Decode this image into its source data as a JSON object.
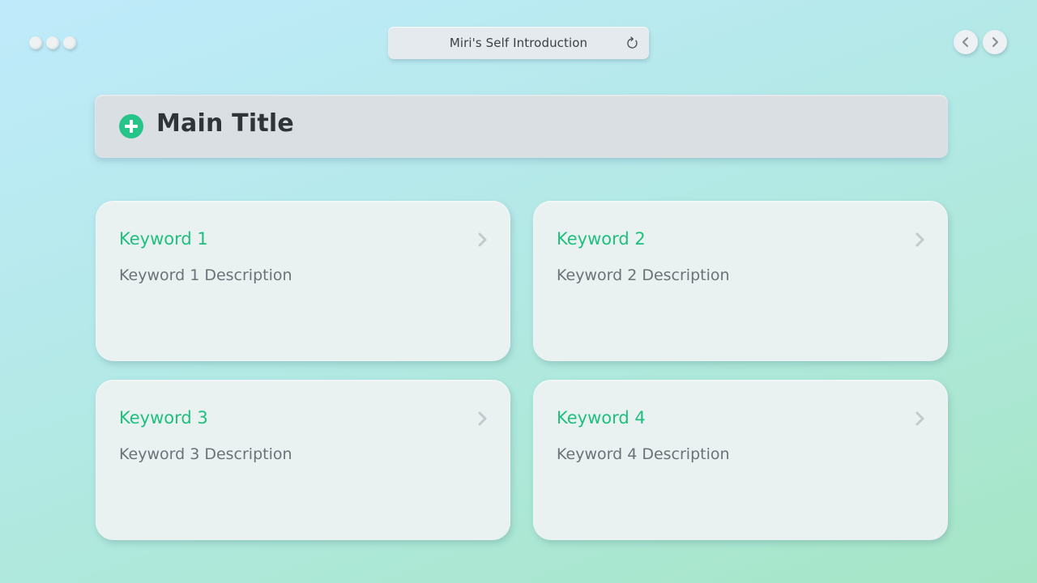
{
  "window": {
    "controls": [
      "dot",
      "dot",
      "dot"
    ]
  },
  "address_bar": {
    "title": "Miri's Self Introduction",
    "refresh_icon": "refresh-icon"
  },
  "navigation": {
    "back_icon": "chevron-left-icon",
    "forward_icon": "chevron-right-icon"
  },
  "header": {
    "icon": "plus-circle-icon",
    "title": "Main Title"
  },
  "cards": [
    {
      "title": "Keyword 1",
      "description": "Keyword 1 Description",
      "icon": "chevron-right-icon"
    },
    {
      "title": "Keyword 2",
      "description": "Keyword 2 Description",
      "icon": "chevron-right-icon"
    },
    {
      "title": "Keyword 3",
      "description": "Keyword 3 Description",
      "icon": "chevron-right-icon"
    },
    {
      "title": "Keyword 4",
      "description": "Keyword 4 Description",
      "icon": "chevron-right-icon"
    }
  ],
  "colors": {
    "accent": "#1fbf7f",
    "plus_icon": "#27c48a",
    "title_text": "#2f3438",
    "description_text": "#6b7379"
  }
}
